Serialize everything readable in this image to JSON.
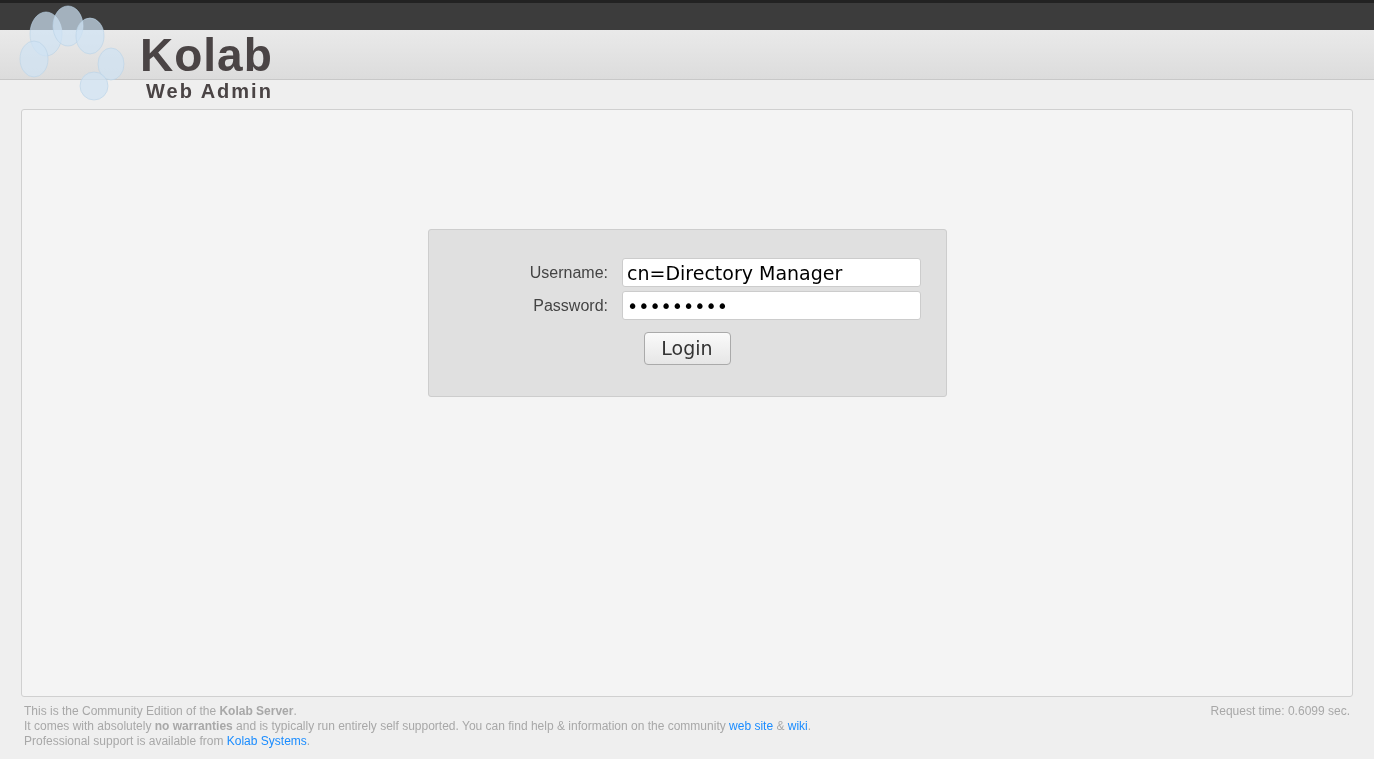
{
  "header": {
    "logo_title": "Kolab",
    "logo_subtitle": "Web Admin"
  },
  "login": {
    "fields": [
      {
        "label": "Username:",
        "value": "cn=Directory Manager"
      },
      {
        "label": "Password:",
        "value": "•••••••••"
      }
    ],
    "button": "Login"
  },
  "footer": {
    "lines": [
      [
        {
          "kind": "text",
          "text": "This is the Community Edition of the **Kolab Server**."
        }
      ],
      [
        {
          "kind": "text",
          "text": "It comes with absolutely **no warranties** and is typically run entirely self supported. You can find help & information on the community "
        },
        {
          "kind": "link",
          "text": "web site"
        },
        {
          "kind": "text",
          "text": " & "
        },
        {
          "kind": "link",
          "text": "wiki"
        },
        {
          "kind": "text",
          "text": "."
        }
      ],
      [
        {
          "kind": "text",
          "text": "Professional support is available from "
        },
        {
          "kind": "link",
          "text": "Kolab Systems"
        },
        {
          "kind": "text",
          "text": "."
        }
      ]
    ],
    "request_time": "Request time: 0.6099 sec."
  }
}
